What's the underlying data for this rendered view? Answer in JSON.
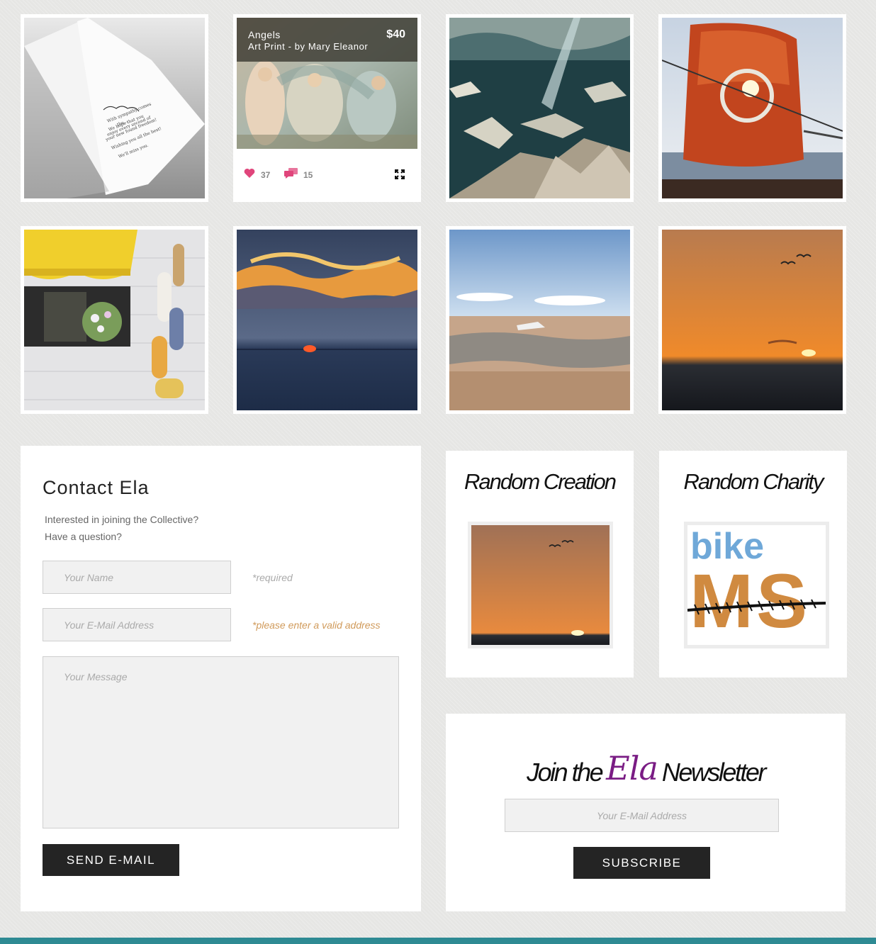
{
  "gallery": {
    "hover_item": {
      "title": "Angels",
      "subtitle": "Art Print - by Mary Eleanor",
      "price": "$40",
      "likes": "37",
      "comments": "15"
    },
    "card_text": [
      "With sympathy comes",
      "the...",
      "We hope that you",
      "enjoy every second of",
      "your new found freedom!",
      "Wishing you all the best!",
      "We'll miss you."
    ]
  },
  "contact": {
    "title": "Contact Ela",
    "intro_line1": "Interested in joining the Collective?",
    "intro_line2": "Have a question?",
    "name_placeholder": "Your Name",
    "name_hint": "*required",
    "email_placeholder": "Your E-Mail Address",
    "email_hint": "*please enter a valid address",
    "message_placeholder": "Your Message",
    "send_label": "SEND E-MAIL"
  },
  "random_creation": {
    "title": "Random Creation"
  },
  "random_charity": {
    "title": "Random Charity",
    "logo_word1": "bike",
    "logo_word2": "MS"
  },
  "newsletter": {
    "title_pre": "Join the",
    "title_brand": "Ela",
    "title_post": "Newsletter",
    "email_placeholder": "Your E-Mail Address",
    "subscribe_label": "SUBSCRIBE"
  },
  "colors": {
    "accent_hint": "#d09a5a",
    "brand_purple": "#7a1c84",
    "footer_teal": "#2e8a93",
    "like_pink": "#e0457b"
  }
}
